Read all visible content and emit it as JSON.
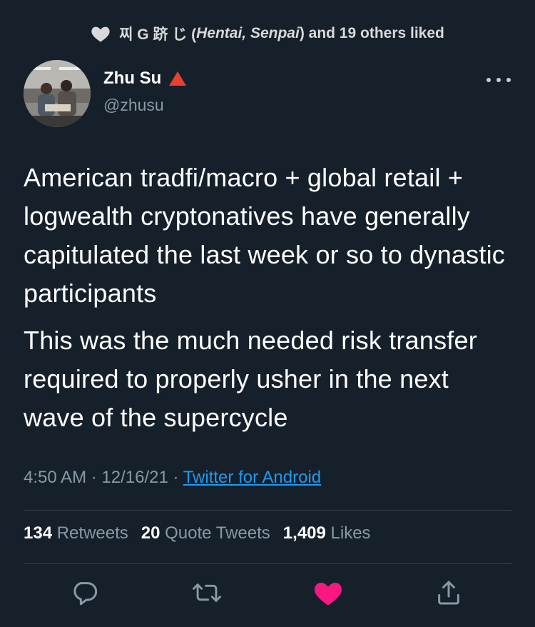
{
  "liked_by": {
    "prefix": "찌 G 跻 じ (",
    "name_italic": "Hentai, Senpai",
    "suffix": ") and 19 others liked"
  },
  "author": {
    "name": "Zhu Su",
    "handle": "@zhusu"
  },
  "tweet": {
    "paragraphs": [
      "American tradfi/macro + global retail + logwealth cryptonatives have generally capitulated the last week or so to dynastic participants",
      "This was the much needed risk transfer required to properly usher in the next wave of the supercycle"
    ]
  },
  "meta": {
    "time": "4:50 AM",
    "separator": " · ",
    "date": "12/16/21",
    "source": "Twitter for Android"
  },
  "stats": {
    "retweets_count": "134",
    "retweets_label": "Retweets",
    "quotes_count": "20",
    "quotes_label": "Quote Tweets",
    "likes_count": "1,409",
    "likes_label": "Likes"
  },
  "colors": {
    "background": "#15202b",
    "accent_link": "#1d9bf0",
    "muted_text": "#8899a6",
    "like_active": "#f91880",
    "divider": "#38444d"
  },
  "icons": {
    "liked_header": "heart-outline-icon",
    "verified_marker": "red-triangle-icon",
    "more": "more-dots-icon",
    "reply": "reply-bubble-icon",
    "retweet": "retweet-icon",
    "like": "heart-filled-icon",
    "share": "share-icon"
  }
}
